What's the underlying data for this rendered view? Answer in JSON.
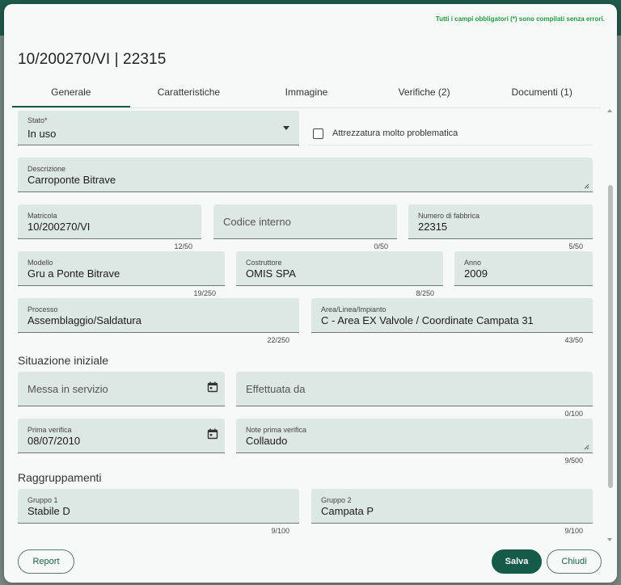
{
  "validation_message": "Tutti i campi obbligatori (*) sono compilati senza errori.",
  "title": "10/200270/VI | 22315",
  "tabs": [
    {
      "label": "Generale"
    },
    {
      "label": "Caratteristiche"
    },
    {
      "label": "Immagine"
    },
    {
      "label": "Verifiche (2)"
    },
    {
      "label": "Documenti (1)"
    }
  ],
  "active_tab": "Generale",
  "fields": {
    "stato": {
      "label": "Stato*",
      "value": "In uso"
    },
    "attrezzatura": {
      "label": "Attrezzatura molto problematica",
      "checked": false
    },
    "descrizione": {
      "label": "Descrizione",
      "value": "Carroponte Bitrave"
    },
    "matricola": {
      "label": "Matricola",
      "value": "10/200270/VI",
      "counter": "12/50"
    },
    "codice_interno": {
      "placeholder": "Codice interno",
      "counter": "0/50"
    },
    "numero_fabbrica": {
      "label": "Numero di fabbrica",
      "value": "22315",
      "counter": "5/50"
    },
    "modello": {
      "label": "Modello",
      "value": "Gru a Ponte Bitrave",
      "counter": "19/250"
    },
    "costruttore": {
      "label": "Costruttore",
      "value": "OMIS SPA",
      "counter": "8/250"
    },
    "anno": {
      "label": "Anno",
      "value": "2009"
    },
    "processo": {
      "label": "Processo",
      "value": "Assemblaggio/Saldatura",
      "counter": "22/250"
    },
    "area": {
      "label": "Area/Linea/Impianto",
      "value": "C - Area EX Valvole / Coordinate Campata 31",
      "counter": "43/50"
    },
    "messa_servizio": {
      "placeholder": "Messa in servizio"
    },
    "effettuata_da": {
      "placeholder": "Effettuata da",
      "counter": "0/100"
    },
    "prima_verifica": {
      "label": "Prima verifica",
      "value": "08/07/2010"
    },
    "note_prima_verifica": {
      "label": "Note prima verifica",
      "value": "Collaudo",
      "counter": "9/500"
    },
    "gruppo1": {
      "label": "Gruppo 1",
      "value": "Stabile D",
      "counter": "9/100"
    },
    "gruppo2": {
      "label": "Gruppo 2",
      "value": "Campata P",
      "counter": "9/100"
    }
  },
  "sections": {
    "situazione": "Situazione iniziale",
    "raggruppamenti": "Raggruppamenti"
  },
  "buttons": {
    "report": "Report",
    "salva": "Salva",
    "chiudi": "Chiudi"
  },
  "colors": {
    "accent": "#165a48",
    "field_bg": "#dde7e4",
    "success_text": "#1f9b3c"
  }
}
